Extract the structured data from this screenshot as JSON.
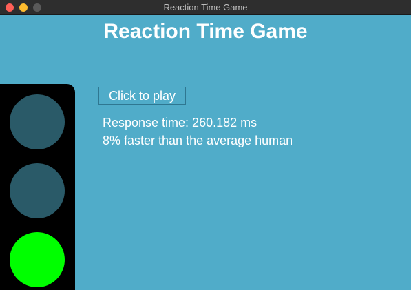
{
  "window": {
    "title": "Reaction Time Game"
  },
  "header": {
    "title": "Reaction Time Game"
  },
  "traffic_light": {
    "lamps": [
      {
        "state": "off",
        "color": "#2a5a68"
      },
      {
        "state": "off",
        "color": "#2a5a68"
      },
      {
        "state": "on",
        "color": "#00ff00"
      }
    ]
  },
  "controls": {
    "play_label": "Click to play"
  },
  "results": {
    "response_time": "Response time: 260.182 ms",
    "comparison": "8% faster than the average human"
  },
  "colors": {
    "background": "#50acc9",
    "housing": "#000000",
    "text": "#ffffff"
  }
}
